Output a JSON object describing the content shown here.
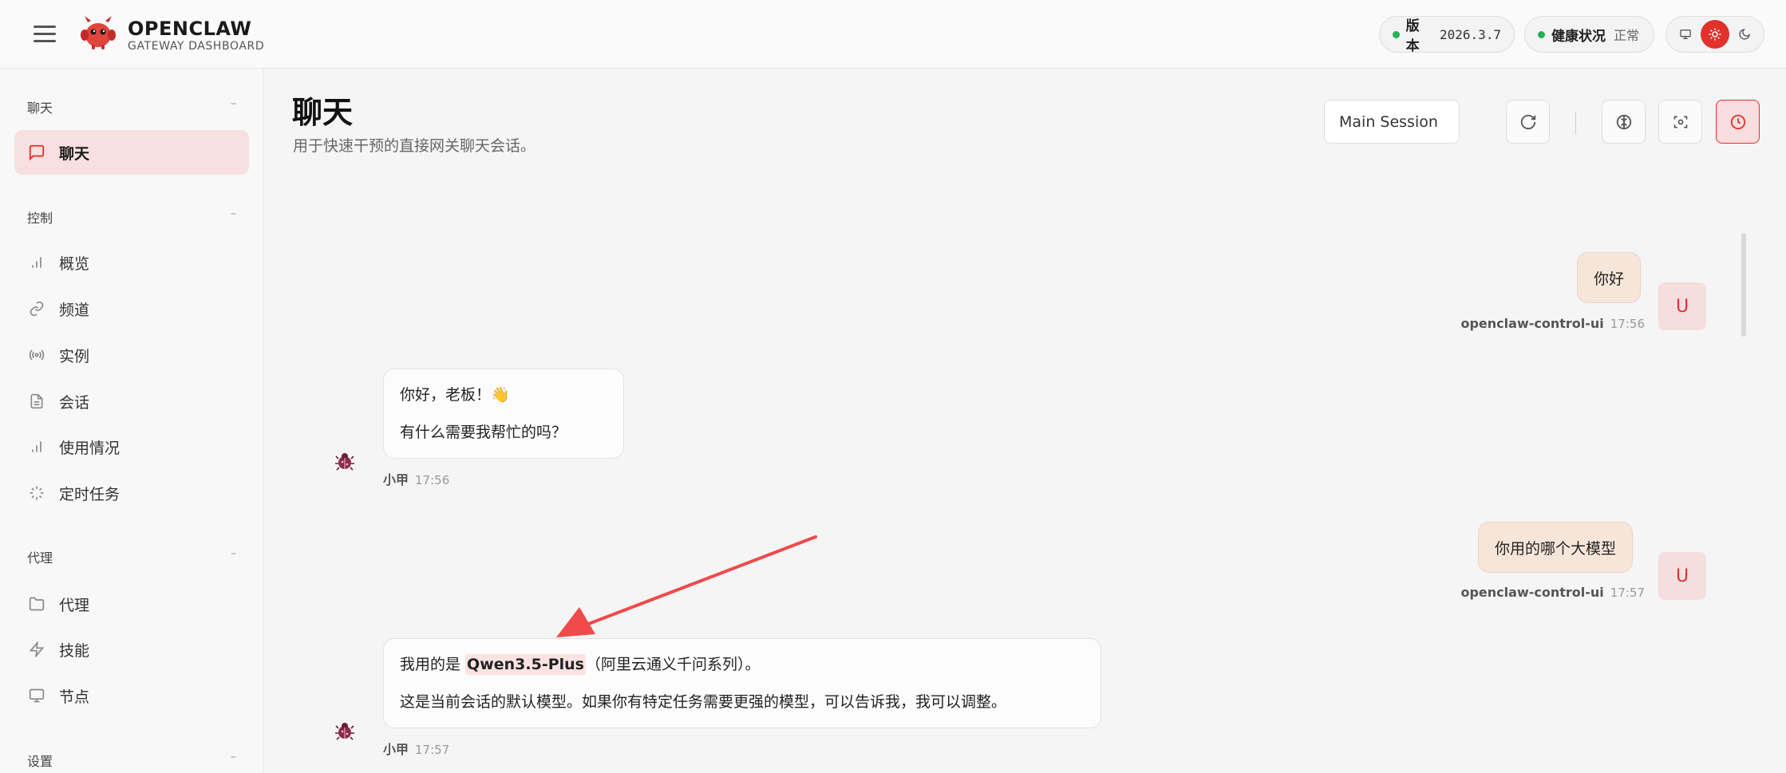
{
  "header": {
    "brand_title": "OPENCLAW",
    "brand_subtitle": "GATEWAY DASHBOARD",
    "version_label": "版本",
    "version_value": "2026.3.7",
    "health_label": "健康状况",
    "health_value": "正常",
    "status_color": "#22b455",
    "accent_color": "#e0322b"
  },
  "sidebar": {
    "groups": [
      {
        "label": "聊天",
        "collapse": "–",
        "items": [
          {
            "label": "聊天",
            "icon": "message-square-icon",
            "active": true
          }
        ]
      },
      {
        "label": "控制",
        "collapse": "–",
        "items": [
          {
            "label": "概览",
            "icon": "bar-chart-icon"
          },
          {
            "label": "频道",
            "icon": "link-icon"
          },
          {
            "label": "实例",
            "icon": "radio-icon"
          },
          {
            "label": "会话",
            "icon": "file-text-icon"
          },
          {
            "label": "使用情况",
            "icon": "bar-chart-icon"
          },
          {
            "label": "定时任务",
            "icon": "loader-icon"
          }
        ]
      },
      {
        "label": "代理",
        "collapse": "–",
        "items": [
          {
            "label": "代理",
            "icon": "folder-icon"
          },
          {
            "label": "技能",
            "icon": "zap-icon"
          },
          {
            "label": "节点",
            "icon": "monitor-icon"
          }
        ]
      },
      {
        "label": "设置",
        "collapse": "–",
        "items": []
      }
    ]
  },
  "main": {
    "title": "聊天",
    "subtitle": "用于快速干预的直接网关聊天会话。",
    "session_select": "Main Session"
  },
  "chat": {
    "messages": [
      {
        "role": "user",
        "avatar": "U",
        "text": "你好",
        "sender": "openclaw-control-ui",
        "time": "17:56"
      },
      {
        "role": "bot",
        "lines": [
          "你好，老板！👋",
          "有什么需要我帮忙的吗？"
        ],
        "sender": "小甲",
        "time": "17:56"
      },
      {
        "role": "user",
        "avatar": "U",
        "text": "你用的哪个大模型",
        "sender": "openclaw-control-ui",
        "time": "17:57"
      },
      {
        "role": "bot",
        "line1_prefix": "我用的是 ",
        "line1_model": "Qwen3.5-Plus",
        "line1_suffix": "（阿里云通义千问系列）。",
        "line2": "这是当前会话的默认模型。如果你有特定任务需要更强的模型，可以告诉我，我可以调整。",
        "sender": "小甲",
        "time": "17:57"
      }
    ]
  }
}
